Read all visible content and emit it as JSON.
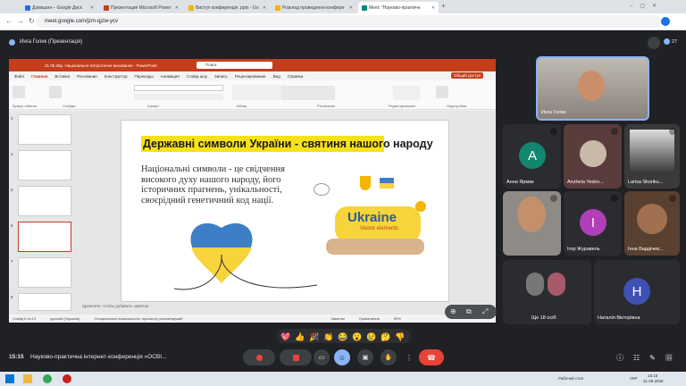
{
  "browser": {
    "tabs": [
      {
        "label": "Домашня – Google Диск",
        "color": "#1a73e8"
      },
      {
        "label": "Презентация Microsoft Power",
        "color": "#c43e1c"
      },
      {
        "label": "Виступ конференція .pptx - Go",
        "color": "#f4b400"
      },
      {
        "label": "Розклад проведення конфере",
        "color": "#f4b400"
      },
      {
        "label": "Meet: \"Науково-практичн",
        "color": "#00897b"
      }
    ],
    "url": "meet.google.com/jzm-qjzw-ycv"
  },
  "meet": {
    "presenter": "Инга Голик (Презентація)",
    "participant_count": "27",
    "time": "15:15",
    "meeting_name": "Науково-практична інтернет-конференція «ОСВІ...",
    "reactions": [
      "💖",
      "👍",
      "🎉",
      "👏",
      "😂",
      "😮",
      "😢",
      "🤔",
      "👎"
    ]
  },
  "powerpoint": {
    "title": "21.05.26р. Національно-патріотичне виховання - PowerPoint",
    "search": "Поиск",
    "menu": [
      "Файл",
      "Главная",
      "Вставка",
      "Рисование",
      "Конструктор",
      "Переходы",
      "Анимация",
      "Слайд-шоу",
      "Запись",
      "Рецензирование",
      "Вид",
      "Справка"
    ],
    "share": "Общий доступ",
    "ribbon_groups": [
      "Буфер обмена",
      "Слайды",
      "Шрифт",
      "Абзац",
      "Рисование",
      "Редактирование",
      "Надстройки"
    ],
    "slide_numbers": [
      "3",
      "4",
      "5",
      "6",
      "7",
      "8"
    ],
    "notes_placeholder": "Щелкните, чтобы добавить заметки",
    "status": [
      "Слайд 6 из 13",
      "русский (Украина)",
      "Специальные возможности: просмотр рекомендаций",
      "Заметки",
      "Примечания",
      "99%"
    ]
  },
  "slide": {
    "title": "Державні символи України - святиня нашого народу",
    "body": "Національні символи - це свідчення високого духу нашого народу, його історичних прагнень, унікальності, своєрідний генетичний код нації.",
    "image_label": "Ukraine",
    "image_sublabel": "Vector elements"
  },
  "participants": [
    {
      "name": "Инга Голик",
      "kind": "video"
    },
    {
      "name": "Анна Ярмак",
      "initial": "А",
      "color": "#12866e"
    },
    {
      "name": "Anzhela Yesko...",
      "kind": "photo"
    },
    {
      "name": "Larisa Skoriku...",
      "kind": "photo"
    },
    {
      "name": "",
      "kind": "video"
    },
    {
      "name": "Ігор Журавель",
      "initial": "І",
      "color": "#b03fb8"
    },
    {
      "name": "Інна Бардічев...",
      "kind": "photo"
    },
    {
      "name": "Ще 18 осіб"
    },
    {
      "name": "Наталія Вікторівна",
      "initial": "Н",
      "color": "#3f51b5"
    }
  ],
  "taskbar": {
    "weather": "Рабочий стол",
    "lang": "УКР",
    "time": "15:15",
    "date": "21.05.2026"
  }
}
